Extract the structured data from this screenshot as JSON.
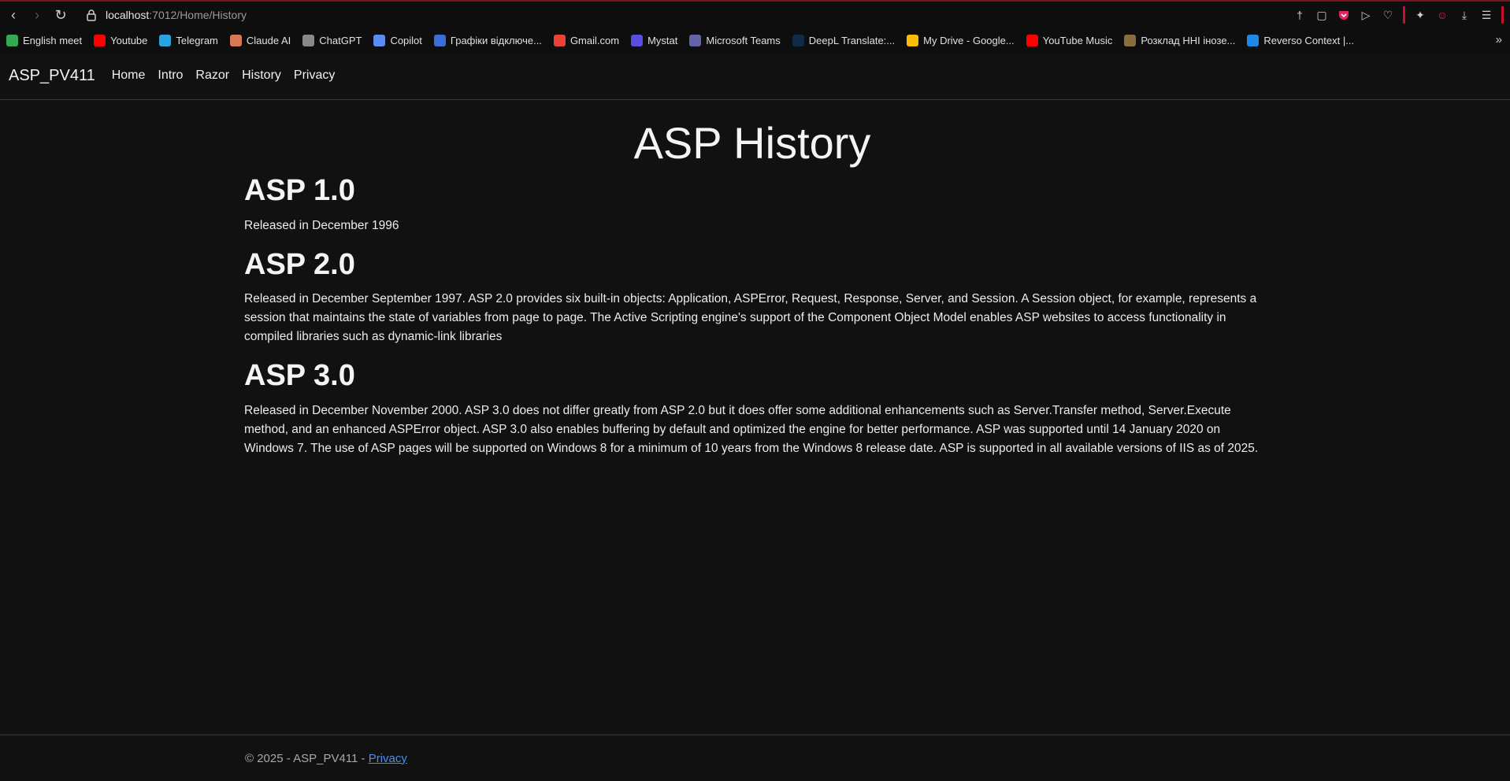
{
  "browser": {
    "url_host": "localhost",
    "url_path": ":7012/Home/History",
    "bookmarks": [
      {
        "label": "English meet",
        "icon": "meet-icon",
        "color": "#34a853"
      },
      {
        "label": "Youtube",
        "icon": "youtube-icon",
        "color": "#ff0000"
      },
      {
        "label": "Telegram",
        "icon": "telegram-icon",
        "color": "#2aa3e0"
      },
      {
        "label": "Claude AI",
        "icon": "claude-icon",
        "color": "#d97757"
      },
      {
        "label": "ChatGPT",
        "icon": "chatgpt-icon",
        "color": "#888888"
      },
      {
        "label": "Copilot",
        "icon": "copilot-icon",
        "color": "#5b8def"
      },
      {
        "label": "Графіки відключе...",
        "icon": "schedule-icon",
        "color": "#3b6fd6"
      },
      {
        "label": "Gmail.com",
        "icon": "gmail-icon",
        "color": "#ea4335"
      },
      {
        "label": "Mystat",
        "icon": "mystat-icon",
        "color": "#5b4de0"
      },
      {
        "label": "Microsoft Teams",
        "icon": "teams-icon",
        "color": "#6264a7"
      },
      {
        "label": "DeepL Translate:...",
        "icon": "deepl-icon",
        "color": "#0f2b46"
      },
      {
        "label": "My Drive - Google...",
        "icon": "drive-icon",
        "color": "#fbbc04"
      },
      {
        "label": "YouTube Music",
        "icon": "youtube-music-icon",
        "color": "#ff0000"
      },
      {
        "label": "Розклад ННІ інозе...",
        "icon": "timetable-icon",
        "color": "#8a6d3b"
      },
      {
        "label": "Reverso Context |...",
        "icon": "reverso-icon",
        "color": "#1e88e5"
      }
    ]
  },
  "navbar": {
    "brand": "ASP_PV411",
    "links": [
      "Home",
      "Intro",
      "Razor",
      "History",
      "Privacy"
    ]
  },
  "page": {
    "title": "ASP History",
    "sections": [
      {
        "heading": "ASP 1.0",
        "text": "Released in December 1996"
      },
      {
        "heading": "ASP 2.0",
        "text": "Released in December September 1997. ASP 2.0 provides six built-in objects: Application, ASPError, Request, Response, Server, and Session. A Session object, for example, represents a session that maintains the state of variables from page to page. The Active Scripting engine's support of the Component Object Model enables ASP websites to access functionality in compiled libraries such as dynamic-link libraries"
      },
      {
        "heading": "ASP 3.0",
        "text": "Released in December November 2000. ASP 3.0 does not differ greatly from ASP 2.0 but it does offer some additional enhancements such as Server.Transfer method, Server.Execute method, and an enhanced ASPError object. ASP 3.0 also enables buffering by default and optimized the engine for better performance. ASP was supported until 14 January 2020 on Windows 7. The use of ASP pages will be supported on Windows 8 for a minimum of 10 years from the Windows 8 release date. ASP is supported in all available versions of IIS as of 2025."
      }
    ]
  },
  "footer": {
    "text": "© 2025 - ASP_PV411 - ",
    "link": "Privacy"
  }
}
